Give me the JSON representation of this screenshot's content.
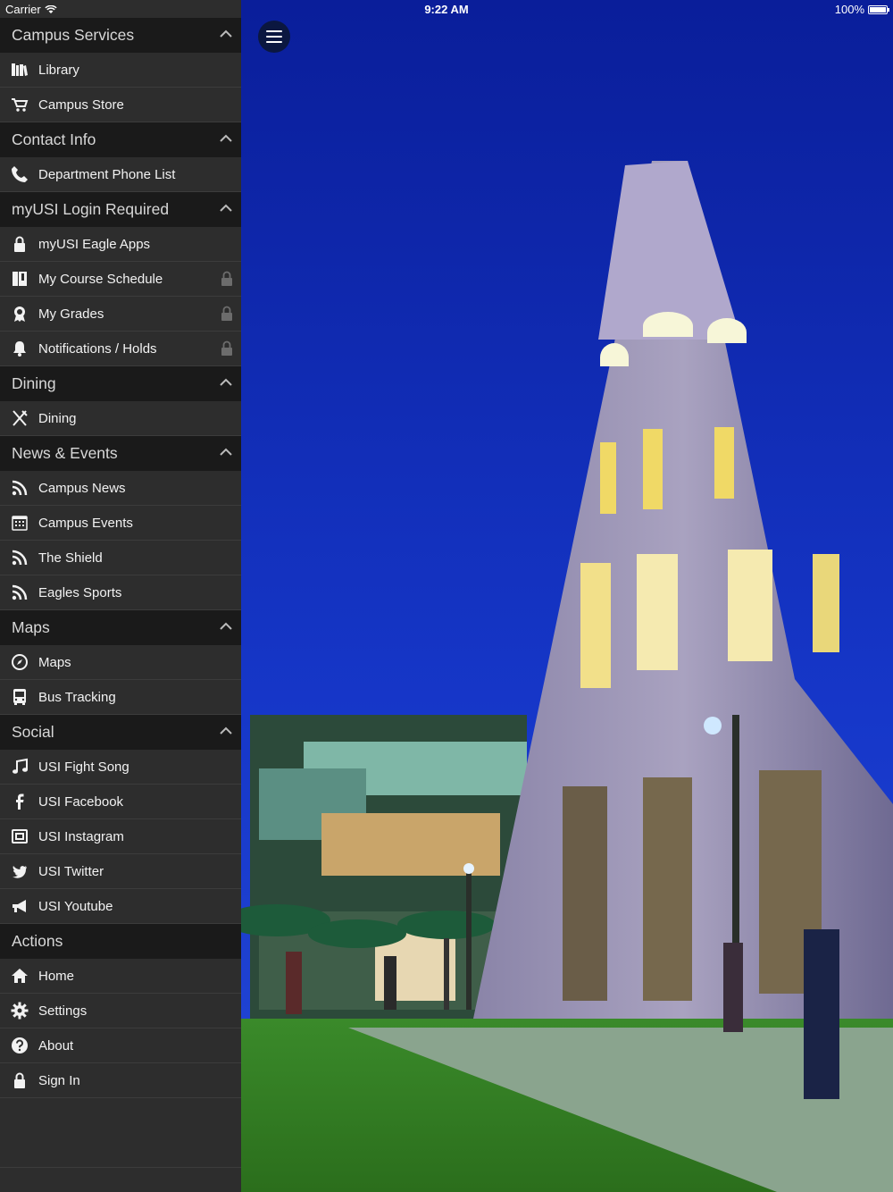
{
  "status_bar": {
    "carrier": "Carrier",
    "time": "9:22 AM",
    "battery": "100%"
  },
  "menu": {
    "sections": [
      {
        "title": "Campus Services",
        "collapsible": true,
        "items": [
          {
            "label": "Library",
            "icon": "library-icon"
          },
          {
            "label": "Campus Store",
            "icon": "cart-icon"
          }
        ]
      },
      {
        "title": "Contact Info",
        "collapsible": true,
        "items": [
          {
            "label": "Department Phone List",
            "icon": "phone-icon"
          }
        ]
      },
      {
        "title": "myUSI Login Required",
        "collapsible": true,
        "items": [
          {
            "label": "myUSI Eagle Apps",
            "icon": "lock-icon"
          },
          {
            "label": "My Course Schedule",
            "icon": "book-icon",
            "locked": true
          },
          {
            "label": "My Grades",
            "icon": "award-icon",
            "locked": true
          },
          {
            "label": "Notifications / Holds",
            "icon": "bell-icon",
            "locked": true
          }
        ]
      },
      {
        "title": "Dining",
        "collapsible": true,
        "items": [
          {
            "label": "Dining",
            "icon": "utensils-icon"
          }
        ]
      },
      {
        "title": "News & Events",
        "collapsible": true,
        "items": [
          {
            "label": "Campus News",
            "icon": "rss-icon"
          },
          {
            "label": "Campus Events",
            "icon": "calendar-icon"
          },
          {
            "label": "The Shield",
            "icon": "rss-icon"
          },
          {
            "label": "Eagles Sports",
            "icon": "rss-icon"
          }
        ]
      },
      {
        "title": "Maps",
        "collapsible": true,
        "items": [
          {
            "label": "Maps",
            "icon": "compass-icon"
          },
          {
            "label": "Bus Tracking",
            "icon": "bus-icon"
          }
        ]
      },
      {
        "title": "Social",
        "collapsible": true,
        "items": [
          {
            "label": "USI Fight Song",
            "icon": "music-icon"
          },
          {
            "label": "USI Facebook",
            "icon": "facebook-icon"
          },
          {
            "label": "USI Instagram",
            "icon": "instagram-icon"
          },
          {
            "label": "USI Twitter",
            "icon": "twitter-icon"
          },
          {
            "label": "USI Youtube",
            "icon": "megaphone-icon"
          }
        ]
      },
      {
        "title": "Actions",
        "collapsible": false,
        "items": [
          {
            "label": "Home",
            "icon": "home-icon"
          },
          {
            "label": "Settings",
            "icon": "gear-icon"
          },
          {
            "label": "About",
            "icon": "question-icon"
          },
          {
            "label": "Sign In",
            "icon": "lock-icon"
          }
        ]
      }
    ]
  },
  "colors": {
    "sidebar_bg": "#2d2d2d",
    "section_bg": "#1a1a1a",
    "sky": "#0d24a8"
  },
  "menu_button_icon": "hamburger-icon",
  "background_image": "campus-tower-night-photo"
}
